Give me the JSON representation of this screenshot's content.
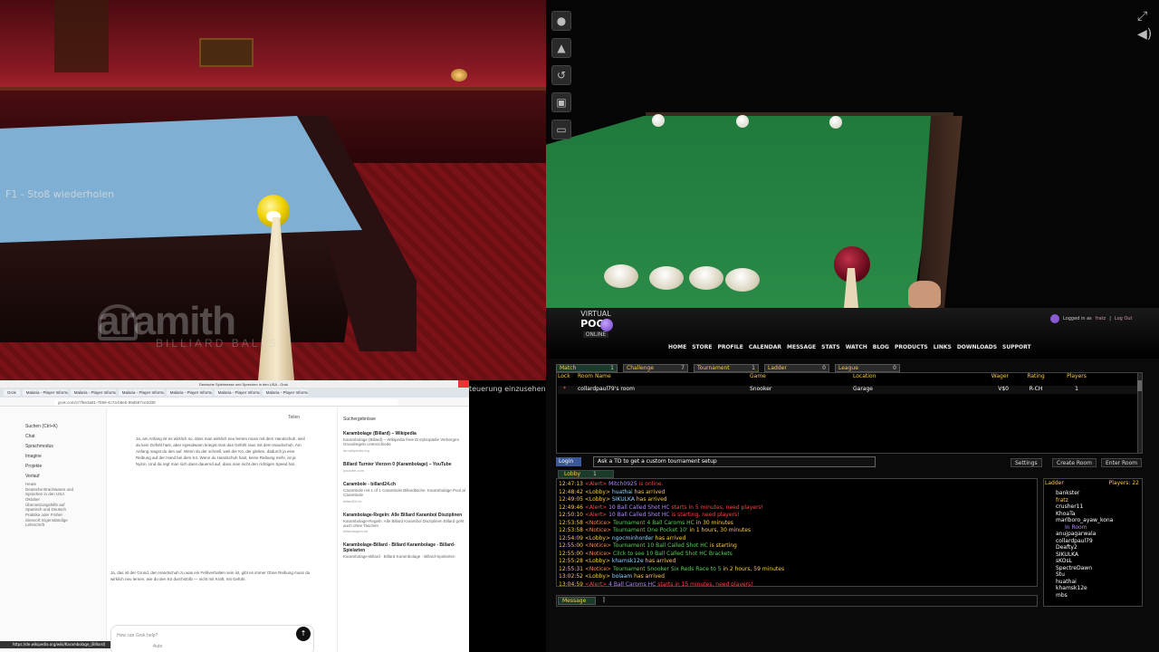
{
  "left_scene": {
    "hint": "F1 - Stoß wiederholen",
    "brand_main": "aramith",
    "brand_sub": "BILLIARD BALLS",
    "overlay_text": "teuerung einzusehen"
  },
  "right_scene": {
    "tools": [
      "ball-rack-icon",
      "triangle-rack-icon",
      "undo-icon",
      "save-icon",
      "folder-icon"
    ]
  },
  "browser": {
    "title": "Deutsche Spielmesse und Sprechen in den USA - Grok",
    "tabs": [
      "Grok",
      "Malaria - Player Informat",
      "Malaria - Player Informat",
      "Malaria - Player Informat",
      "Malaria - Player Informat",
      "Malaria - Player Informat",
      "Malaria - Player Informat"
    ],
    "url": "grok.com/c/7f6e3a81-7b59-4c7a-b8eb-99d587ce2d38",
    "sidebar": {
      "search": "Suchen (Ctrl+K)",
      "items": [
        "Chat",
        "Sprachmodus",
        "Imagine",
        "Projekte",
        "Verlauf"
      ],
      "history_label": "Heute",
      "history": [
        "Deutsche Brachwaren und Sprachen in den USA",
        "Oktober",
        "Übersetzungshilfe auf Spanisch und Deutsch",
        "Praktika oder Früher",
        "Sinnvoll: Eigenständige Lehrschrift"
      ]
    },
    "share": "Teilen",
    "text1": "Ja, am Anfang ist es wirklich so, dass man wirklich neu lernen muss mit dem Handschuh, weil du kein Gefühl hast, aber irgendwann kriegst man das Gefühl raus mit dem Handschuh. Am Anfang reagst du den auf. Wenn du der schnell, weil der Kö, der gleiten, dadurch ja eine Reibung auf der Hand bei dem Kö. Wenn du Handschuh hast, keine Reibung mehr, ist ja Nylon. Und da regt man sich dann dauernd auf, dass man nicht den richtigen Speed hat.",
    "text2": "Ja, das ist der Grund, den Handschuh zu was ein Fehlverhalten sein ist, gibt es immer Ohne Reibung muss du wirklich neu lernen, wie du den Kö durchstößt — nicht mit Kraft, mit Gefühl.",
    "input_placeholder": "How can Grok help?",
    "model": "Auto",
    "right_title": "Suchergebnisse",
    "sources": [
      {
        "title": "Karambolage (Billard) – Wikipedia",
        "desc": "Karambolage (Billard) – Wikipedia freie Enzyklopädie Verbergen Grundregeln Unterschiede",
        "site": "de.wikipedia.org"
      },
      {
        "title": "Billard Turnier Vierzen 0 (Karambolage) – YouTube",
        "desc": "",
        "site": "youtube.com"
      },
      {
        "title": "Carambole - billard24.ch",
        "desc": "Carambole mit 1 of 1 Carambole Billardtische. Karambolage Pool al Carambole",
        "site": "billard24.ch"
      },
      {
        "title": "Karambolage-Regeln: Alle Billard Karambol Disziplinen",
        "desc": "Karambolage-Regeln: Alle Billard Karambol Disziplinen Billard geht auch ohne Taschen",
        "site": "billardregeln.de"
      },
      {
        "title": "Karambolage-Billard - Billard Karambolage - Billard-Spielarten",
        "desc": "Karambolage-Billard · Billard Karambolage · Billard-Spielarten",
        "site": ""
      }
    ],
    "status_url": "https://de.wikipedia.org/wiki/Karambolage_(Billard)"
  },
  "vpo": {
    "logo_top": "VIRTUAL",
    "logo_main": "POOL",
    "logo_sub": "ONLINE",
    "login_prefix": "Logged in as",
    "login_user": "fratz",
    "logout": "Log Out",
    "nav": [
      "HOME",
      "STORE",
      "PROFILE",
      "CALENDAR",
      "MESSAGE",
      "STATS",
      "WATCH",
      "BLOG",
      "PRODUCTS",
      "LINKS",
      "DOWNLOADS",
      "SUPPORT"
    ],
    "tabs": [
      {
        "label": "Match",
        "count": "1"
      },
      {
        "label": "Challenge",
        "count": "7"
      },
      {
        "label": "Tournament",
        "count": "1"
      },
      {
        "label": "Ladder",
        "count": "0"
      },
      {
        "label": "League",
        "count": "0"
      }
    ],
    "room_headers": [
      "Lock",
      "Room Name",
      "Game",
      "Location",
      "Wager",
      "Rating",
      "Players"
    ],
    "room": {
      "lock": "*",
      "name": "collardpaul79's room",
      "game": "Snooker",
      "location": "Garage",
      "wager": "V$0",
      "rating": "R-CH",
      "players": "1"
    },
    "fb_login": "Login",
    "promo": "Ask a TD to get a custom tournament setup",
    "settings": "Settings",
    "create_room": "Create Room",
    "enter_room": "Enter Room",
    "chat_tab": "Lobby",
    "chat_tab_count": "1",
    "chat": [
      {
        "time": "12:47:13",
        "tag": "<Alert>",
        "type": "alert",
        "name": "Mitch0925",
        "text": " is online."
      },
      {
        "time": "12:48:42",
        "tag": "<Lobby>",
        "type": "lobby",
        "name": "huathai",
        "text": " has arrived"
      },
      {
        "time": "12:49:05",
        "tag": "<Lobby>",
        "type": "lobby",
        "name": "SIKULKA",
        "text": " has arrived"
      },
      {
        "time": "12:49:46",
        "tag": "<Alert>",
        "type": "alert",
        "name": "10 Ball Called Shot HC",
        "text": " starts in 5 minutes, need players!"
      },
      {
        "time": "12:50:10",
        "tag": "<Alert>",
        "type": "alert",
        "name": "10 Ball Called Shot HC",
        "text": " is starting, need players!"
      },
      {
        "time": "12:53:58",
        "tag": "<Notice>",
        "type": "notice",
        "name": "Tournament 4 Ball Caroms HC",
        "text": " in 30 minutes"
      },
      {
        "time": "12:53:58",
        "tag": "<Notice>",
        "type": "notice",
        "name": "Tournament One Pocket 10'",
        "text": " in 1 hours, 30 minutes"
      },
      {
        "time": "12:54:09",
        "tag": "<Lobby>",
        "type": "lobby",
        "name": "ngocminhorder",
        "text": " has arrived"
      },
      {
        "time": "12:55:00",
        "tag": "<Notice>",
        "type": "notice",
        "name": "Tournament 10 Ball Called Shot HC",
        "text": " is starting"
      },
      {
        "time": "12:55:00",
        "tag": "<Notice>",
        "type": "notice",
        "name": "Click to see 10 Ball Called Shot HC Brackets",
        "text": ""
      },
      {
        "time": "12:55:28",
        "tag": "<Lobby>",
        "type": "lobby",
        "name": "khamsk12e",
        "text": " has arrived"
      },
      {
        "time": "12:55:31",
        "tag": "<Notice>",
        "type": "notice",
        "name": "Tournament Snooker Six Reds Race to 5",
        "text": " in 2 hours, 59 minutes"
      },
      {
        "time": "13:02:52",
        "tag": "<Lobby>",
        "type": "lobby",
        "name": "bolaam",
        "text": " has arrived"
      },
      {
        "time": "13:04:59",
        "tag": "<Alert>",
        "type": "alert",
        "name": "4 Ball Caroms HC",
        "text": " starts in 15 minutes, need players!"
      }
    ],
    "message_label": "Message",
    "ladder_label": "Ladder",
    "players_label": "Players:",
    "players_count": "22",
    "ladder": [
      "bankster",
      "fratz",
      "crusher11",
      "KhoaTa",
      "marlboro_ayaw_kona"
    ],
    "in_room_label": "In Room",
    "in_room": [
      "anujpagarwala",
      "collardpaul79",
      "Deafty2",
      "SIKULKA",
      "sKOsL",
      "SpectreDawn",
      "Stu",
      "huathai",
      "khamsk12e",
      "mbs"
    ]
  }
}
